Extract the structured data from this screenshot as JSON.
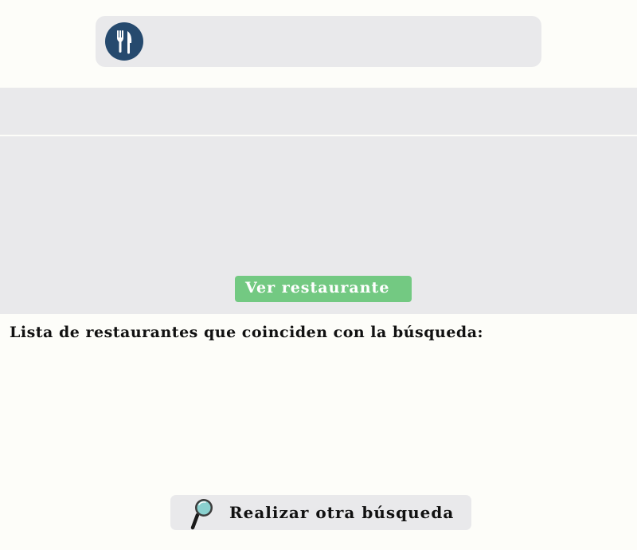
{
  "header": {
    "logo_icon": "fork-knife-icon",
    "logo_color": "#264a6e"
  },
  "restaurant_panel": {
    "view_button_label": "Ver restaurante",
    "button_color": "#73c982"
  },
  "results": {
    "heading": "Lista de restaurantes que coinciden con la búsqueda:"
  },
  "footer": {
    "search_again_label": "Realizar otra búsqueda",
    "search_icon": "magnifier-icon"
  }
}
